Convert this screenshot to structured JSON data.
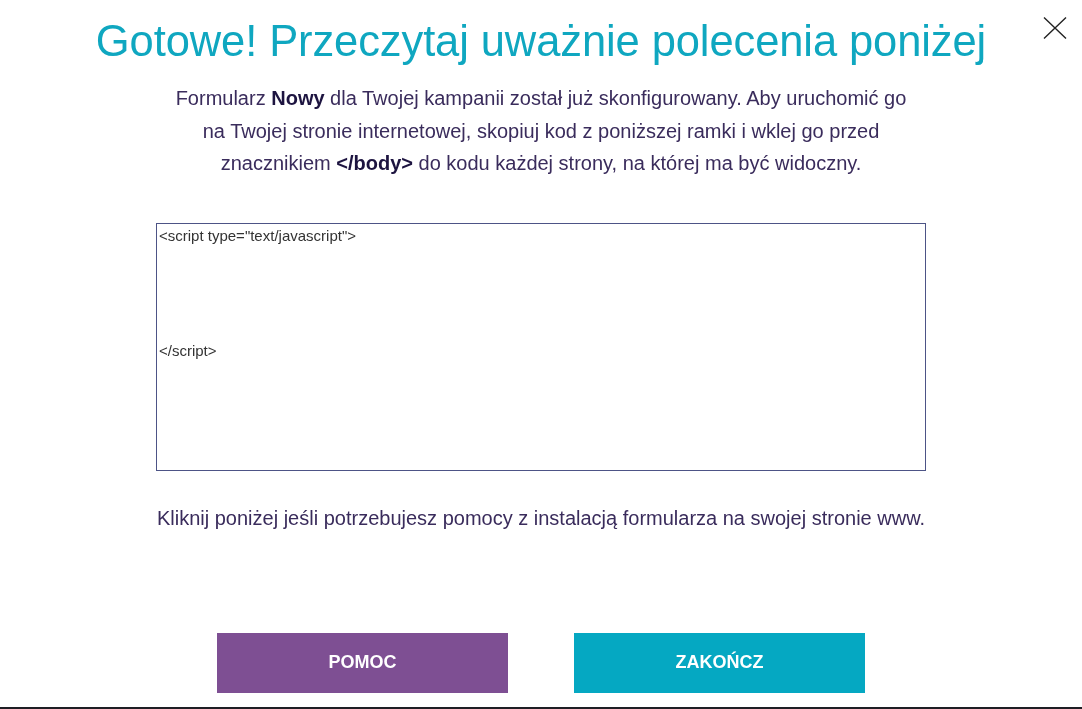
{
  "dialog": {
    "title": "Gotowe! Przeczytaj uważnie polecenia poniżej",
    "instructions": "Formularz **Nowy** dla Twojej kampanii został już skonfigurowany. Aby uruchomić go na Twojej stronie internetowej, skopiuj kod z poniższej ramki i wklej go przed znacznikiem **</body>** do kodu każdej strony, na której ma być widoczny.",
    "code_field": {
      "value": "<script type=\"text/javascript\">\n\n\n\n\n\n</script>"
    },
    "help_text": "Kliknij poniżej jeśli potrzebujesz pomocy z instalacją formularza na swojej stronie www.",
    "buttons": [
      {
        "label": "POMOC",
        "kind": "secondary"
      },
      {
        "label": "ZAKOŃCZ",
        "kind": "primary"
      }
    ]
  }
}
